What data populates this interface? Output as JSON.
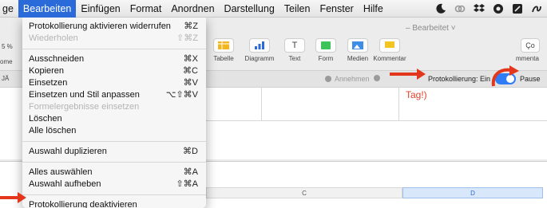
{
  "menubar": {
    "items": [
      {
        "label": "ge",
        "active": false
      },
      {
        "label": "Bearbeiten",
        "active": true
      },
      {
        "label": "Einfügen",
        "active": false
      },
      {
        "label": "Format",
        "active": false
      },
      {
        "label": "Anordnen",
        "active": false
      },
      {
        "label": "Darstellung",
        "active": false
      },
      {
        "label": "Teilen",
        "active": false
      },
      {
        "label": "Fenster",
        "active": false
      },
      {
        "label": "Hilfe",
        "active": false
      }
    ],
    "status_icons": [
      "moon-icon",
      "link-icon",
      "dropbox-icon",
      "circle-icon",
      "square-icon",
      "script-icon"
    ]
  },
  "window": {
    "title": "– Bearbeitet ˅",
    "toolbar": [
      {
        "label": "Tabelle",
        "icon": "table-icon"
      },
      {
        "label": "Diagramm",
        "icon": "chart-icon"
      },
      {
        "label": "Text",
        "icon": "text-icon"
      },
      {
        "label": "Form",
        "icon": "shape-icon"
      },
      {
        "label": "Medien",
        "icon": "media-icon"
      },
      {
        "label": "Kommentar",
        "icon": "comment-icon"
      }
    ],
    "left_stubs": [
      "5 %",
      "ome",
      "JÄ"
    ],
    "right_stubs": [
      "Ço",
      "mmenta"
    ],
    "subbar": {
      "accept": "Annehmen",
      "tracking_label": "Protokollierung: Ein",
      "pause": "Pause"
    },
    "comment_text": "Tag!)",
    "column_headers": [
      "C",
      "D"
    ]
  },
  "colors": {
    "accent": "#2b6bd9",
    "arrow": "#e2371d",
    "comment": "#e0442c"
  },
  "menu": {
    "groups": [
      [
        {
          "label": "Protokollierung aktivieren widerrufen",
          "shortcut": "⌘Z",
          "disabled": false
        },
        {
          "label": "Wiederholen",
          "shortcut": "⇧⌘Z",
          "disabled": true
        }
      ],
      [
        {
          "label": "Ausschneiden",
          "shortcut": "⌘X",
          "disabled": false
        },
        {
          "label": "Kopieren",
          "shortcut": "⌘C",
          "disabled": false
        },
        {
          "label": "Einsetzen",
          "shortcut": "⌘V",
          "disabled": false
        },
        {
          "label": "Einsetzen und Stil anpassen",
          "shortcut": "⌥⇧⌘V",
          "disabled": false
        },
        {
          "label": "Formelergebnisse einsetzen",
          "shortcut": "",
          "disabled": true
        },
        {
          "label": "Löschen",
          "shortcut": "",
          "disabled": false
        },
        {
          "label": "Alle löschen",
          "shortcut": "",
          "disabled": false
        }
      ],
      [
        {
          "label": "Auswahl duplizieren",
          "shortcut": "⌘D",
          "disabled": false
        }
      ],
      [
        {
          "label": "Alles auswählen",
          "shortcut": "⌘A",
          "disabled": false
        },
        {
          "label": "Auswahl aufheben",
          "shortcut": "⇧⌘A",
          "disabled": false
        }
      ],
      [
        {
          "label": "Protokollierung deaktivieren",
          "shortcut": "",
          "disabled": false
        }
      ]
    ]
  }
}
